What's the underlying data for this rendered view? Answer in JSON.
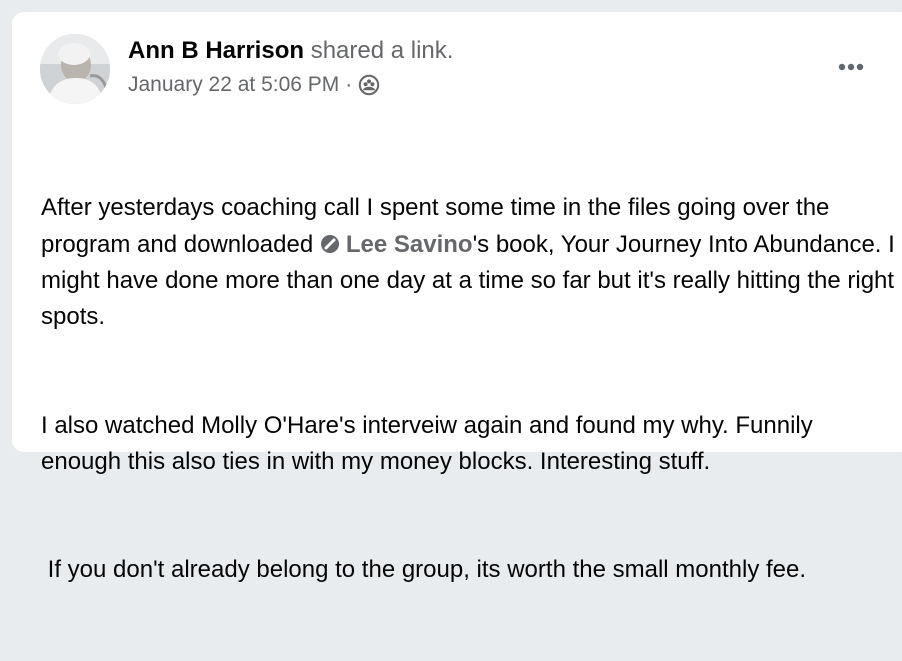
{
  "post": {
    "author": {
      "name": "Ann B Harrison",
      "action": "shared a link.",
      "avatar_icon": "profile-photo"
    },
    "timestamp": "January 22 at 5:06 PM",
    "separator": "·",
    "audience_icon": "group-members-icon",
    "more_icon": "ellipsis-icon",
    "body": {
      "para1_before": "After yesterdays coaching call I spent some time in the files going over the program and downloaded ",
      "mention_icon": "badge-icon",
      "mention": "Lee Savino",
      "para1_after": "'s book, Your Journey Into Abundance. I might have done more than one day at a time so far but it's really hitting the right spots.",
      "para2": "I also watched Molly O'Hare's interveiw again and found my why. Funnily enough this also ties in with my money blocks. Interesting stuff.",
      "para3": " If you don't already belong to the group, its worth the small monthly fee."
    }
  },
  "colors": {
    "name_text": "#050505",
    "secondary_text": "#65676b",
    "card_bg": "#ffffff",
    "page_bg": "#e9ecef"
  }
}
